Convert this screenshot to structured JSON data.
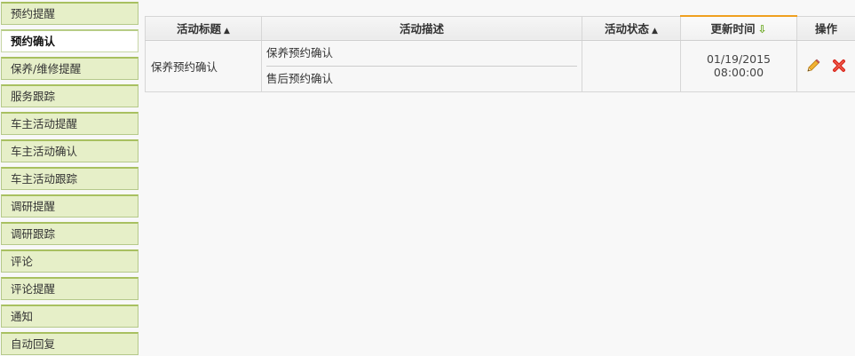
{
  "sidebar": {
    "items": [
      {
        "label": "预约提醒",
        "active": false
      },
      {
        "label": "预约确认",
        "active": true
      },
      {
        "label": "保养/维修提醒",
        "active": false
      },
      {
        "label": "服务跟踪",
        "active": false
      },
      {
        "label": "车主活动提醒",
        "active": false
      },
      {
        "label": "车主活动确认",
        "active": false
      },
      {
        "label": "车主活动跟踪",
        "active": false
      },
      {
        "label": "调研提醒",
        "active": false
      },
      {
        "label": "调研跟踪",
        "active": false
      },
      {
        "label": "评论",
        "active": false
      },
      {
        "label": "评论提醒",
        "active": false
      },
      {
        "label": "通知",
        "active": false
      },
      {
        "label": "自动回复",
        "active": false
      }
    ]
  },
  "table": {
    "headers": {
      "title": "活动标题",
      "desc": "活动描述",
      "status": "活动状态",
      "updated": "更新时间",
      "ops": "操作"
    },
    "rows": [
      {
        "title": "保养预约确认",
        "desc": [
          "保养预约确认",
          "售后预约确认"
        ],
        "status": "",
        "updated": "01/19/2015 08:00:00"
      }
    ]
  },
  "icons": {
    "sort": "sort-both-icon",
    "sort_desc": "arrow-down-icon",
    "edit": "pencil-icon",
    "delete": "x-delete-icon"
  },
  "colors": {
    "sidebar_bg": "#e6efc8",
    "sidebar_border": "#a8c060",
    "sorted_header_accent": "#f0a020",
    "sort_arrow": "#6aa820",
    "delete_red": "#d9261c"
  }
}
